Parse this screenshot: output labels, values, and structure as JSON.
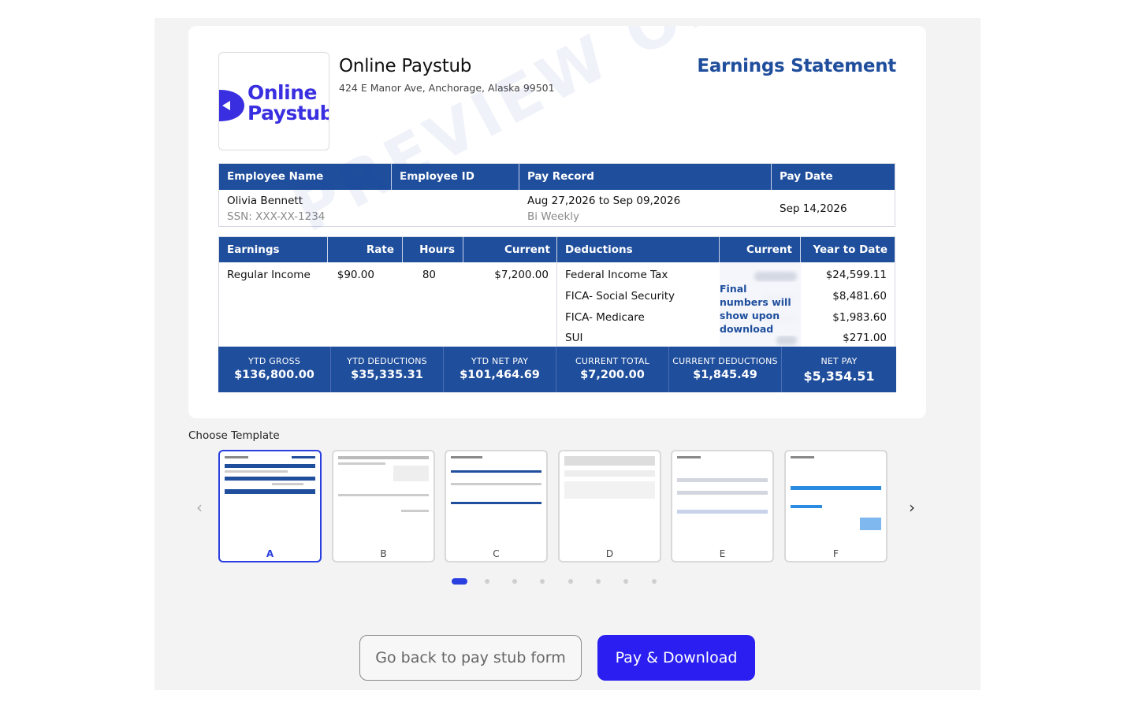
{
  "company": {
    "logo_line1": "Online",
    "logo_line2": "Paystub",
    "name": "Online Paystub",
    "address": "424 E Manor Ave, Anchorage, Alaska 99501"
  },
  "statement_title": "Earnings Statement",
  "watermark": "PREVIEW ONLY",
  "employee_table": {
    "headers": [
      "Employee Name",
      "Employee ID",
      "Pay Record",
      "Pay Date"
    ],
    "name": "Olivia Bennett",
    "ssn": "SSN: XXX-XX-1234",
    "pay_record": "Aug 27,2026 to Sep 09,2026",
    "frequency": "Bi Weekly",
    "pay_date": "Sep 14,2026"
  },
  "earnings": {
    "headers": [
      "Earnings",
      "Rate",
      "Hours",
      "Current"
    ],
    "rows": [
      {
        "name": "Regular Income",
        "rate": "$90.00",
        "hours": "80",
        "current": "$7,200.00"
      }
    ]
  },
  "deductions": {
    "headers": [
      "Deductions",
      "Current",
      "Year to Date"
    ],
    "note": "Final numbers will show upon download",
    "rows": [
      {
        "name": "Federal Income Tax",
        "ytd": "$24,599.11"
      },
      {
        "name": "FICA- Social Security",
        "ytd": "$8,481.60"
      },
      {
        "name": "FICA- Medicare",
        "ytd": "$1,983.60"
      },
      {
        "name": "SUI",
        "ytd": "$271.00"
      }
    ]
  },
  "totals": [
    {
      "label": "YTD GROSS",
      "value": "$136,800.00"
    },
    {
      "label": "YTD DEDUCTIONS",
      "value": "$35,335.31"
    },
    {
      "label": "YTD NET PAY",
      "value": "$101,464.69"
    },
    {
      "label": "CURRENT TOTAL",
      "value": "$7,200.00"
    },
    {
      "label": "CURRENT DEDUCTIONS",
      "value": "$1,845.49"
    },
    {
      "label": "NET PAY",
      "value": "$5,354.51"
    }
  ],
  "template_picker": {
    "label": "Choose Template",
    "prev": "‹",
    "next": "›",
    "templates": [
      "A",
      "B",
      "C",
      "D",
      "E",
      "F"
    ],
    "selected": "A",
    "page_count": 8,
    "active_page": 1
  },
  "actions": {
    "back_label": "Go back to pay stub form",
    "pay_label": "Pay & Download"
  },
  "colors": {
    "primary_blue": "#1f4e9c",
    "button_blue": "#2a1ff0",
    "logo_purple": "#3a2fe0"
  }
}
